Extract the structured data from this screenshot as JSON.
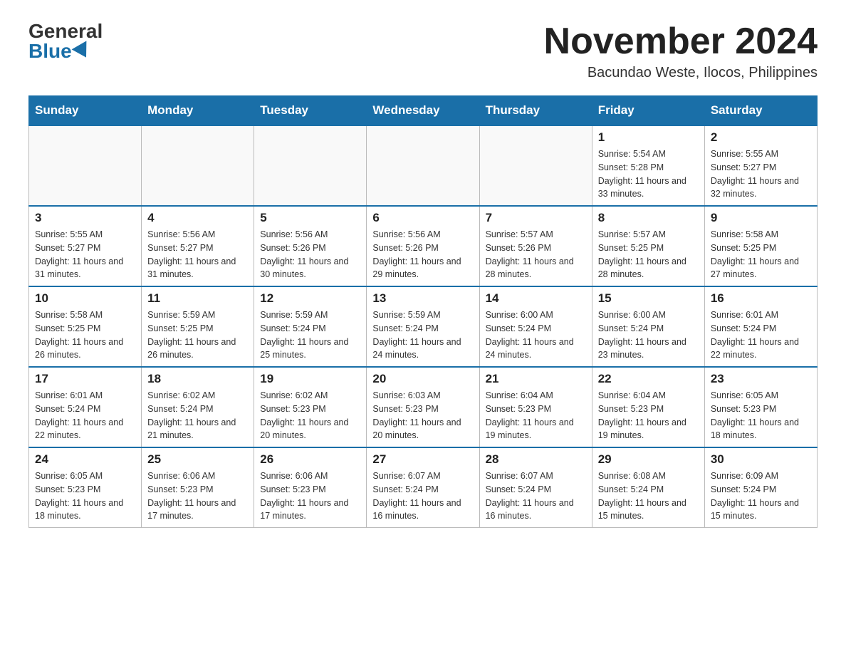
{
  "header": {
    "logo_general": "General",
    "logo_blue": "Blue",
    "month_title": "November 2024",
    "location": "Bacundao Weste, Ilocos, Philippines"
  },
  "weekdays": [
    "Sunday",
    "Monday",
    "Tuesday",
    "Wednesday",
    "Thursday",
    "Friday",
    "Saturday"
  ],
  "weeks": [
    [
      {
        "day": "",
        "info": ""
      },
      {
        "day": "",
        "info": ""
      },
      {
        "day": "",
        "info": ""
      },
      {
        "day": "",
        "info": ""
      },
      {
        "day": "",
        "info": ""
      },
      {
        "day": "1",
        "info": "Sunrise: 5:54 AM\nSunset: 5:28 PM\nDaylight: 11 hours and 33 minutes."
      },
      {
        "day": "2",
        "info": "Sunrise: 5:55 AM\nSunset: 5:27 PM\nDaylight: 11 hours and 32 minutes."
      }
    ],
    [
      {
        "day": "3",
        "info": "Sunrise: 5:55 AM\nSunset: 5:27 PM\nDaylight: 11 hours and 31 minutes."
      },
      {
        "day": "4",
        "info": "Sunrise: 5:56 AM\nSunset: 5:27 PM\nDaylight: 11 hours and 31 minutes."
      },
      {
        "day": "5",
        "info": "Sunrise: 5:56 AM\nSunset: 5:26 PM\nDaylight: 11 hours and 30 minutes."
      },
      {
        "day": "6",
        "info": "Sunrise: 5:56 AM\nSunset: 5:26 PM\nDaylight: 11 hours and 29 minutes."
      },
      {
        "day": "7",
        "info": "Sunrise: 5:57 AM\nSunset: 5:26 PM\nDaylight: 11 hours and 28 minutes."
      },
      {
        "day": "8",
        "info": "Sunrise: 5:57 AM\nSunset: 5:25 PM\nDaylight: 11 hours and 28 minutes."
      },
      {
        "day": "9",
        "info": "Sunrise: 5:58 AM\nSunset: 5:25 PM\nDaylight: 11 hours and 27 minutes."
      }
    ],
    [
      {
        "day": "10",
        "info": "Sunrise: 5:58 AM\nSunset: 5:25 PM\nDaylight: 11 hours and 26 minutes."
      },
      {
        "day": "11",
        "info": "Sunrise: 5:59 AM\nSunset: 5:25 PM\nDaylight: 11 hours and 26 minutes."
      },
      {
        "day": "12",
        "info": "Sunrise: 5:59 AM\nSunset: 5:24 PM\nDaylight: 11 hours and 25 minutes."
      },
      {
        "day": "13",
        "info": "Sunrise: 5:59 AM\nSunset: 5:24 PM\nDaylight: 11 hours and 24 minutes."
      },
      {
        "day": "14",
        "info": "Sunrise: 6:00 AM\nSunset: 5:24 PM\nDaylight: 11 hours and 24 minutes."
      },
      {
        "day": "15",
        "info": "Sunrise: 6:00 AM\nSunset: 5:24 PM\nDaylight: 11 hours and 23 minutes."
      },
      {
        "day": "16",
        "info": "Sunrise: 6:01 AM\nSunset: 5:24 PM\nDaylight: 11 hours and 22 minutes."
      }
    ],
    [
      {
        "day": "17",
        "info": "Sunrise: 6:01 AM\nSunset: 5:24 PM\nDaylight: 11 hours and 22 minutes."
      },
      {
        "day": "18",
        "info": "Sunrise: 6:02 AM\nSunset: 5:24 PM\nDaylight: 11 hours and 21 minutes."
      },
      {
        "day": "19",
        "info": "Sunrise: 6:02 AM\nSunset: 5:23 PM\nDaylight: 11 hours and 20 minutes."
      },
      {
        "day": "20",
        "info": "Sunrise: 6:03 AM\nSunset: 5:23 PM\nDaylight: 11 hours and 20 minutes."
      },
      {
        "day": "21",
        "info": "Sunrise: 6:04 AM\nSunset: 5:23 PM\nDaylight: 11 hours and 19 minutes."
      },
      {
        "day": "22",
        "info": "Sunrise: 6:04 AM\nSunset: 5:23 PM\nDaylight: 11 hours and 19 minutes."
      },
      {
        "day": "23",
        "info": "Sunrise: 6:05 AM\nSunset: 5:23 PM\nDaylight: 11 hours and 18 minutes."
      }
    ],
    [
      {
        "day": "24",
        "info": "Sunrise: 6:05 AM\nSunset: 5:23 PM\nDaylight: 11 hours and 18 minutes."
      },
      {
        "day": "25",
        "info": "Sunrise: 6:06 AM\nSunset: 5:23 PM\nDaylight: 11 hours and 17 minutes."
      },
      {
        "day": "26",
        "info": "Sunrise: 6:06 AM\nSunset: 5:23 PM\nDaylight: 11 hours and 17 minutes."
      },
      {
        "day": "27",
        "info": "Sunrise: 6:07 AM\nSunset: 5:24 PM\nDaylight: 11 hours and 16 minutes."
      },
      {
        "day": "28",
        "info": "Sunrise: 6:07 AM\nSunset: 5:24 PM\nDaylight: 11 hours and 16 minutes."
      },
      {
        "day": "29",
        "info": "Sunrise: 6:08 AM\nSunset: 5:24 PM\nDaylight: 11 hours and 15 minutes."
      },
      {
        "day": "30",
        "info": "Sunrise: 6:09 AM\nSunset: 5:24 PM\nDaylight: 11 hours and 15 minutes."
      }
    ]
  ]
}
